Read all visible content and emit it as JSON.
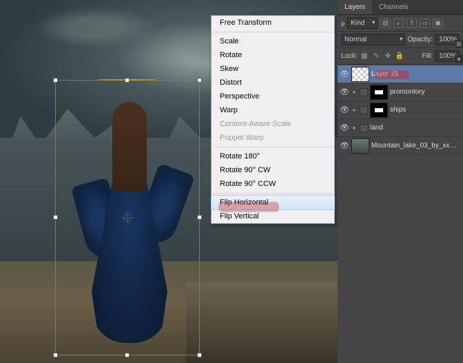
{
  "context_menu": {
    "items": [
      {
        "label": "Free Transform",
        "type": "item"
      },
      {
        "type": "sep"
      },
      {
        "label": "Scale",
        "type": "item"
      },
      {
        "label": "Rotate",
        "type": "item"
      },
      {
        "label": "Skew",
        "type": "item"
      },
      {
        "label": "Distort",
        "type": "item"
      },
      {
        "label": "Perspective",
        "type": "item"
      },
      {
        "label": "Warp",
        "type": "item"
      },
      {
        "label": "Content-Aware Scale",
        "type": "item",
        "disabled": true
      },
      {
        "label": "Puppet Warp",
        "type": "item",
        "disabled": true
      },
      {
        "type": "sep"
      },
      {
        "label": "Rotate 180°",
        "type": "item"
      },
      {
        "label": "Rotate 90° CW",
        "type": "item"
      },
      {
        "label": "Rotate 90° CCW",
        "type": "item"
      },
      {
        "type": "sep"
      },
      {
        "label": "Flip Horizontal",
        "type": "item",
        "highlighted": true
      },
      {
        "label": "Flip Vertical",
        "type": "item"
      }
    ]
  },
  "panel": {
    "tabs": {
      "layers": "Layers",
      "channels": "Channels"
    },
    "filter": {
      "kind": "Kind"
    },
    "blend": {
      "mode": "Normal",
      "opacity_label": "Opacity:",
      "opacity": "100%"
    },
    "lock": {
      "label": "Lock:",
      "fill_label": "Fill:",
      "fill": "100%"
    },
    "layers": [
      {
        "name": "Layer 19",
        "selected": true
      },
      {
        "name": "promontory",
        "group": true
      },
      {
        "name": "ships",
        "group": true
      },
      {
        "name": "land",
        "group": true
      },
      {
        "name": "Mountain_lake_03_by_xxM...",
        "image": true
      }
    ]
  }
}
